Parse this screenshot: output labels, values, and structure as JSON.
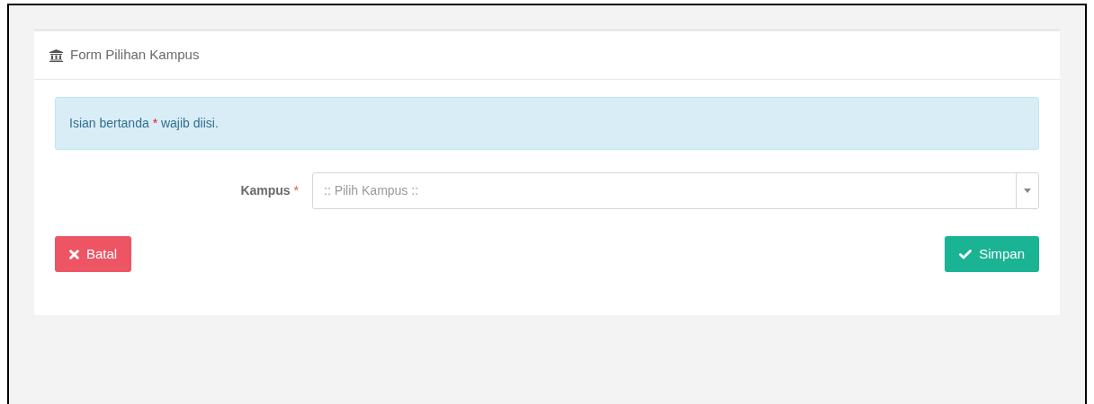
{
  "panel": {
    "title": "Form Pilihan Kampus"
  },
  "alert": {
    "text_before": "Isian bertanda",
    "required_mark": "*",
    "text_after": "wajib diisi."
  },
  "fields": [
    {
      "label": "Kampus",
      "required_mark": "*",
      "placeholder": ":: Pilih Kampus ::"
    }
  ],
  "buttons": [
    {
      "kind": "cancel",
      "label": "Batal"
    },
    {
      "kind": "save",
      "label": "Simpan"
    }
  ]
}
